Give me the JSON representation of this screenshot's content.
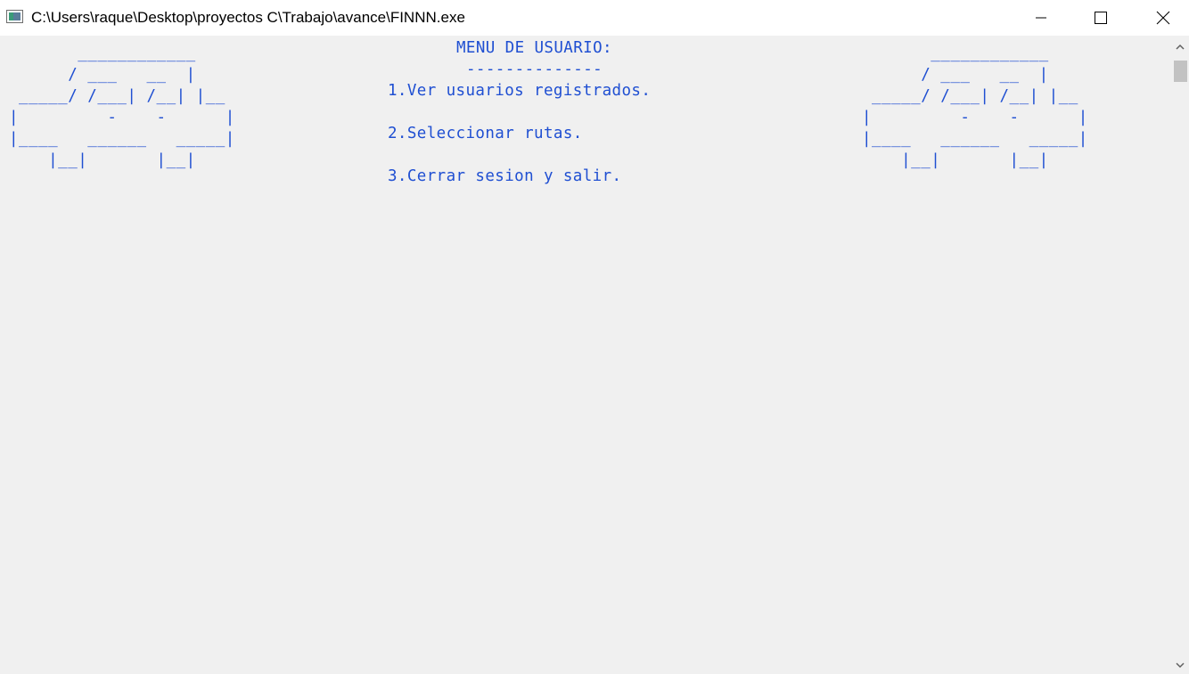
{
  "window": {
    "title": "C:\\Users\\raque\\Desktop\\proyectos C\\Trabajo\\avance\\FINNN.exe",
    "controls": {
      "minimize": "minimize-icon",
      "maximize": "maximize-icon",
      "close": "close-icon"
    }
  },
  "console": {
    "text_color": "#1f4fd2",
    "background": "#f0f0f0",
    "ascii_car_left": "       ____________\n      / ___   __  |\n _____/ /___| /__| |__\n|         -    -      |\n|____   ______   _____|\n    |__|       |__|",
    "ascii_car_right": "       ____________\n      / ___   __  |\n _____/ /___| /__| |__\n|         -    -      |\n|____   ______   _____|\n    |__|       |__|",
    "menu": {
      "title": "MENU DE USUARIO:",
      "underline": "--------------",
      "options": [
        "1.Ver usuarios registrados.",
        "2.Seleccionar rutas.",
        "3.Cerrar sesion y salir."
      ]
    }
  }
}
